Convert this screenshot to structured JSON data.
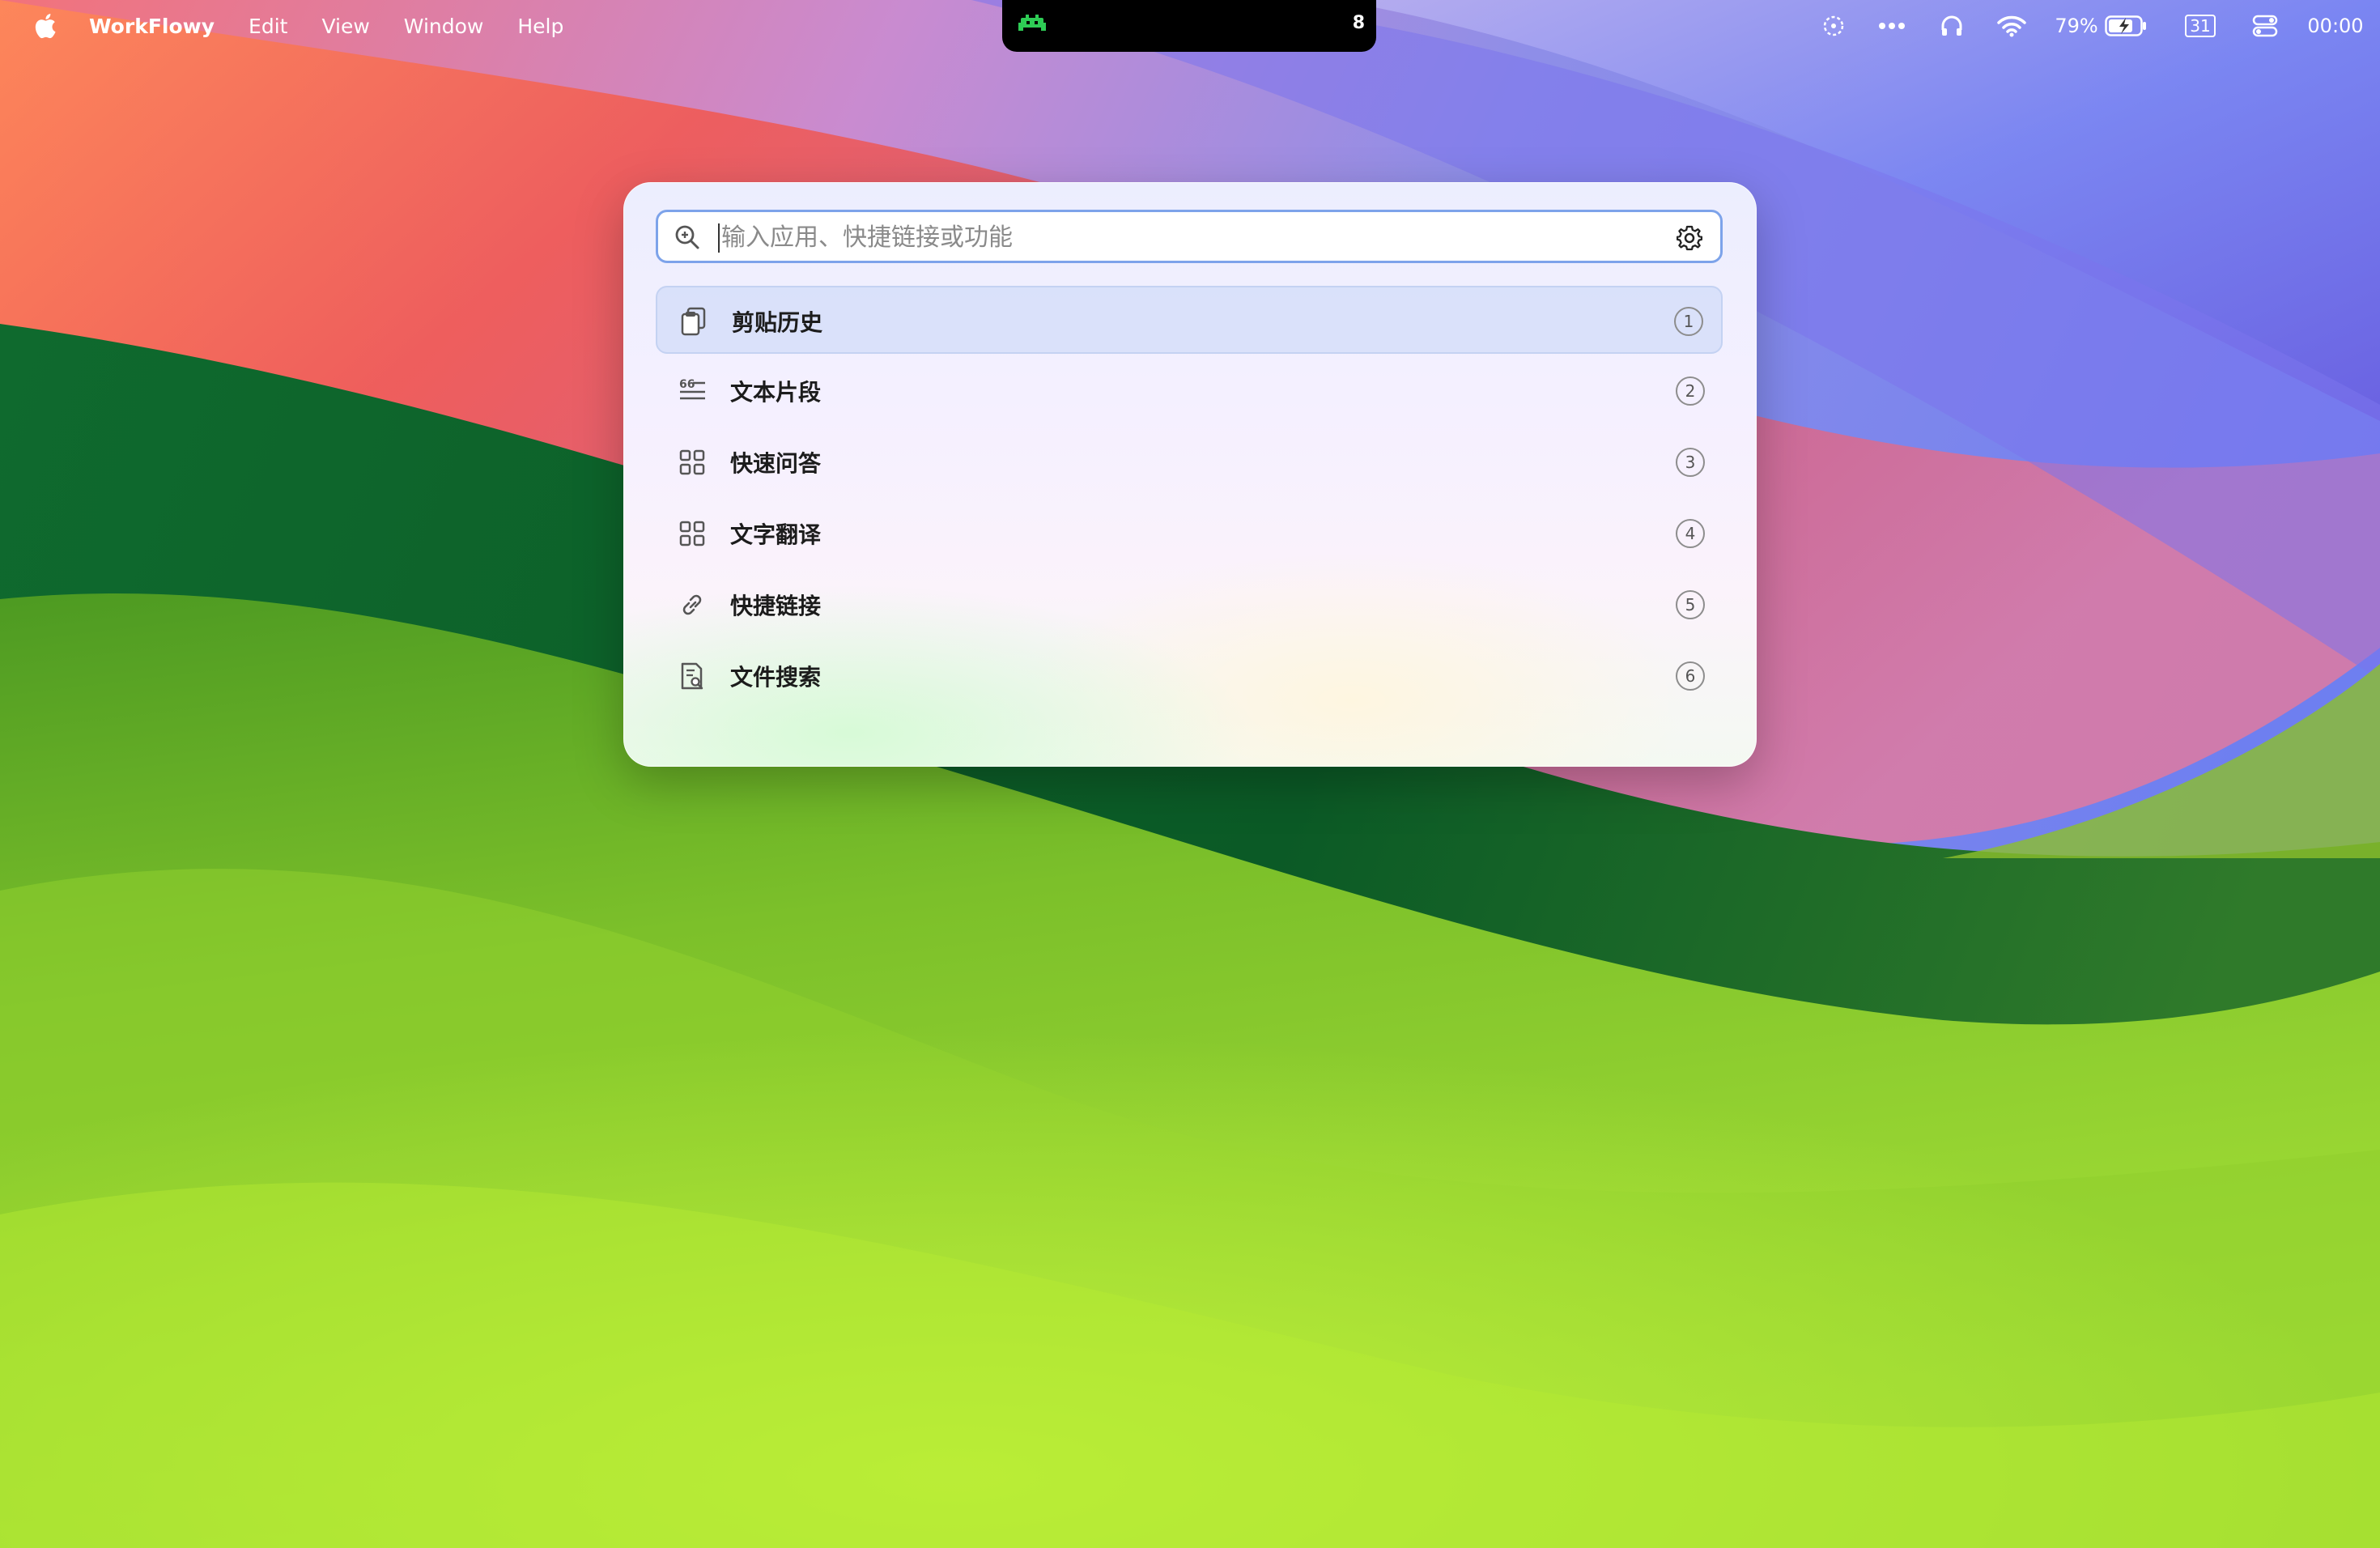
{
  "menubar": {
    "app_name": "WorkFlowy",
    "menus": [
      "Edit",
      "View",
      "Window",
      "Help"
    ],
    "notch_badge": "8",
    "battery_percent": "79%",
    "calendar_day": "31",
    "clock": "00:00",
    "status_icons": [
      "focus-icon",
      "more-icon",
      "headphones-icon",
      "wifi-icon",
      "battery-icon",
      "calendar-icon",
      "control-center-icon"
    ]
  },
  "launcher": {
    "search": {
      "placeholder": "输入应用、快捷链接或功能",
      "value": ""
    },
    "items": [
      {
        "label": "剪贴历史",
        "key": "1",
        "icon": "clipboard-icon",
        "selected": true
      },
      {
        "label": "文本片段",
        "key": "2",
        "icon": "text-snippet-icon",
        "selected": false
      },
      {
        "label": "快速问答",
        "key": "3",
        "icon": "grid-icon",
        "selected": false
      },
      {
        "label": "文字翻译",
        "key": "4",
        "icon": "grid-icon",
        "selected": false
      },
      {
        "label": "快捷链接",
        "key": "5",
        "icon": "link-icon",
        "selected": false
      },
      {
        "label": "文件搜索",
        "key": "6",
        "icon": "file-search-icon",
        "selected": false
      }
    ]
  },
  "colors": {
    "accent": "#7da3ea",
    "selected_row": "#d2dcf8"
  }
}
